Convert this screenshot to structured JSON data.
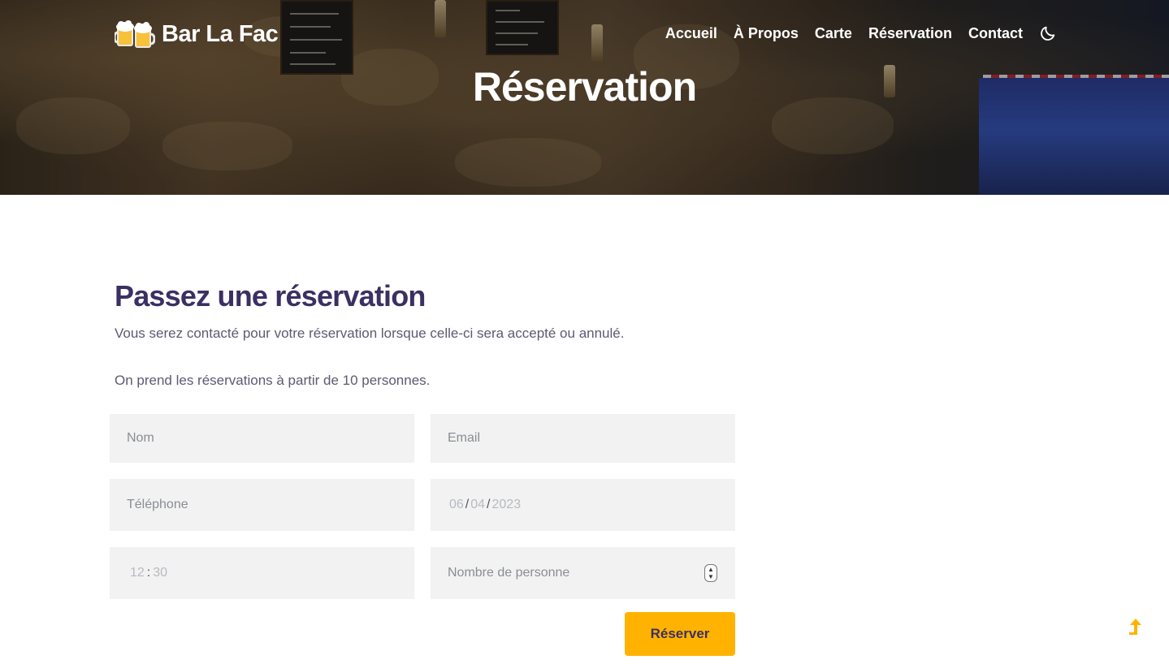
{
  "header": {
    "brand": "Bar La Fac",
    "nav": [
      "Accueil",
      "À Propos",
      "Carte",
      "Réservation",
      "Contact"
    ],
    "theme_toggle_icon": "moon-icon",
    "logo_icon": "beer-mugs-icon"
  },
  "hero": {
    "title": "Réservation"
  },
  "form_section": {
    "title": "Passez une réservation",
    "info_1": "Vous serez contacté pour votre réservation lorsque celle-ci sera accepté ou annulé.",
    "info_2": "On prend les réservations à partir de 10 personnes.",
    "fields": {
      "name_placeholder": "Nom",
      "email_placeholder": "Email",
      "phone_placeholder": "Téléphone",
      "date": {
        "day": "06",
        "month": "04",
        "year": "2023"
      },
      "time": {
        "hour": "12",
        "minute": "30"
      },
      "people_placeholder": "Nombre de personne"
    },
    "submit_label": "Réserver"
  },
  "scroll_top_icon": "arrow-up-icon",
  "colors": {
    "accent": "#ffb300",
    "heading": "#3c2f63",
    "field_bg": "#f2f2f2"
  }
}
